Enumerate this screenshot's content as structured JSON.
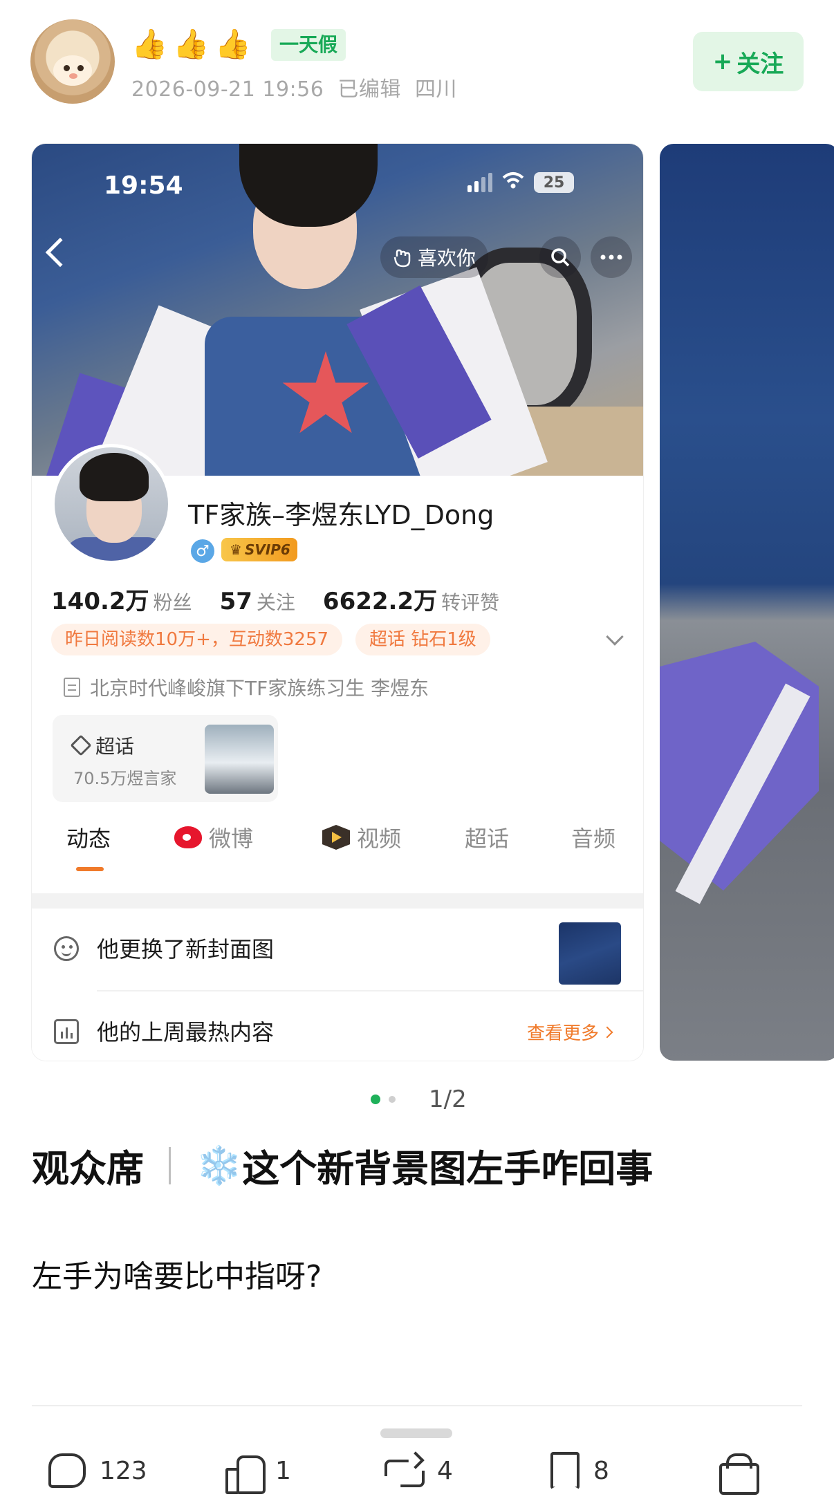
{
  "header": {
    "emojis": [
      "👍",
      "👍",
      "👍"
    ],
    "tag": "一天假",
    "timestamp": "2026-09-21 19:56",
    "edited": "已编辑",
    "location": "四川",
    "follow_plus": "+",
    "follow_label": "关注"
  },
  "carousel": {
    "status_bar": {
      "time": "19:54",
      "battery": "25"
    },
    "like_label": "喜欢你",
    "profile": {
      "name": "TF家族–李煜东LYD_Dong",
      "gender": "♂",
      "svip": "SVIP6",
      "stats": [
        {
          "value": "140.2万",
          "label": "粉丝"
        },
        {
          "value": "57",
          "label": "关注"
        },
        {
          "value": "6622.2万",
          "label": "转评赞"
        }
      ],
      "pill_reads": "昨日阅读数10万+，互动数3257",
      "pill_supertopic": "超话 钻石1级",
      "bio": "北京时代峰峻旗下TF家族练习生 李煜东",
      "supertopic_card": {
        "title": "超话",
        "subtitle": "70.5万煜言家"
      }
    },
    "tabs": [
      "动态",
      "微博",
      "视频",
      "超话",
      "音频"
    ],
    "active_tab": 0,
    "rows": [
      {
        "text": "他更换了新封面图"
      },
      {
        "text": "他的上周最热内容",
        "action": "查看更多"
      }
    ],
    "pager": "1/2",
    "page_index": 1,
    "page_count": 2
  },
  "post": {
    "title_left": "观众席",
    "title_emoji": "❄️",
    "title_right": "这个新背景图左手咋回事",
    "body": "左手为啥要比中指呀?"
  },
  "actions": {
    "comments": "123",
    "likes": "1",
    "reposts": "4",
    "favorites": "8"
  },
  "colors": {
    "accent_green": "#18a957",
    "accent_orange": "#f07a2a",
    "weibo_red": "#e6162d"
  },
  "icons": [
    "avatar",
    "back-arrow-icon",
    "search-icon",
    "more-icon",
    "wifi-icon",
    "signal-icon",
    "gender-male-icon",
    "supertopic-diamond-icon",
    "document-icon",
    "weibo-logo-icon",
    "video-logo-icon",
    "smile-icon",
    "chart-icon",
    "chevron-right-icon",
    "comment-icon",
    "like-icon",
    "repost-icon",
    "bookmark-icon",
    "gift-icon"
  ]
}
